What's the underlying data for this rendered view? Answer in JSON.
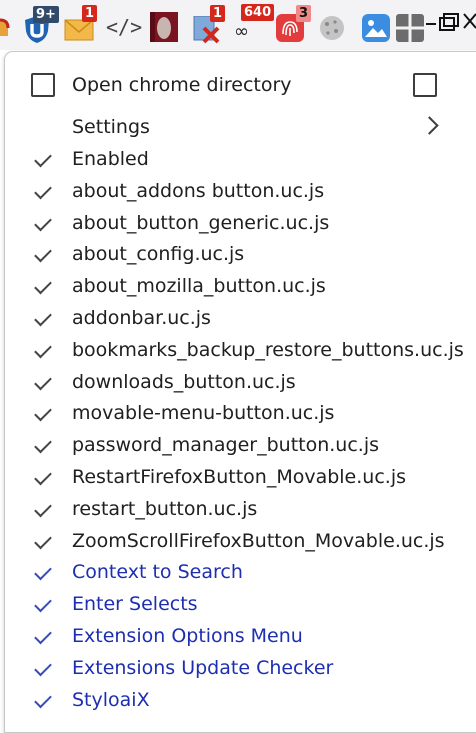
{
  "toolbar": {
    "icons": [
      {
        "name": "red-partial-icon"
      },
      {
        "name": "ublock-shield-icon",
        "badge": "9+"
      },
      {
        "name": "mail-envelope-icon",
        "badge": "1"
      },
      {
        "name": "code-brackets-icon",
        "text": "</>"
      },
      {
        "name": "photo-thumbnail-icon"
      },
      {
        "name": "blocked-page-icon",
        "badge": "1"
      },
      {
        "name": "infinity-counter-icon",
        "badge": "640",
        "text": "∞"
      },
      {
        "name": "fingerprint-icon",
        "badge": "3"
      },
      {
        "name": "cookie-icon"
      },
      {
        "name": "image-picture-icon"
      },
      {
        "name": "grid-puzzle-icon"
      }
    ],
    "colors": {
      "badge": "#d4281c",
      "badge_dark": "#314a6a",
      "toolbar_bg": "#f3f3f5"
    }
  },
  "menu": {
    "open_directory_label": "Open chrome directory",
    "settings_label": "Settings",
    "items": [
      {
        "label": "Enabled",
        "checked": true,
        "style": "normal"
      },
      {
        "label": "about_addons button.uc.js",
        "checked": true,
        "style": "normal"
      },
      {
        "label": "about_button_generic.uc.js",
        "checked": true,
        "style": "normal"
      },
      {
        "label": "about_config.uc.js",
        "checked": true,
        "style": "normal"
      },
      {
        "label": "about_mozilla_button.uc.js",
        "checked": true,
        "style": "normal"
      },
      {
        "label": "addonbar.uc.js",
        "checked": true,
        "style": "normal"
      },
      {
        "label": "bookmarks_backup_restore_buttons.uc.js",
        "checked": true,
        "style": "normal"
      },
      {
        "label": "downloads_button.uc.js",
        "checked": true,
        "style": "normal"
      },
      {
        "label": "movable-menu-button.uc.js",
        "checked": true,
        "style": "normal"
      },
      {
        "label": "password_manager_button.uc.js",
        "checked": true,
        "style": "normal"
      },
      {
        "label": "RestartFirefoxButton_Movable.uc.js",
        "checked": true,
        "style": "normal"
      },
      {
        "label": "restart_button.uc.js",
        "checked": true,
        "style": "normal"
      },
      {
        "label": "ZoomScrollFirefoxButton_Movable.uc.js",
        "checked": true,
        "style": "normal"
      },
      {
        "label": "Context to Search",
        "checked": true,
        "style": "blue"
      },
      {
        "label": "Enter Selects",
        "checked": true,
        "style": "blue"
      },
      {
        "label": "Extension Options Menu",
        "checked": true,
        "style": "blue"
      },
      {
        "label": "Extensions Update Checker",
        "checked": true,
        "style": "blue"
      },
      {
        "label": "StyloaiX",
        "checked": true,
        "style": "blue"
      }
    ],
    "colors": {
      "text": "#202020",
      "blue_text": "#1d2fb0"
    }
  }
}
